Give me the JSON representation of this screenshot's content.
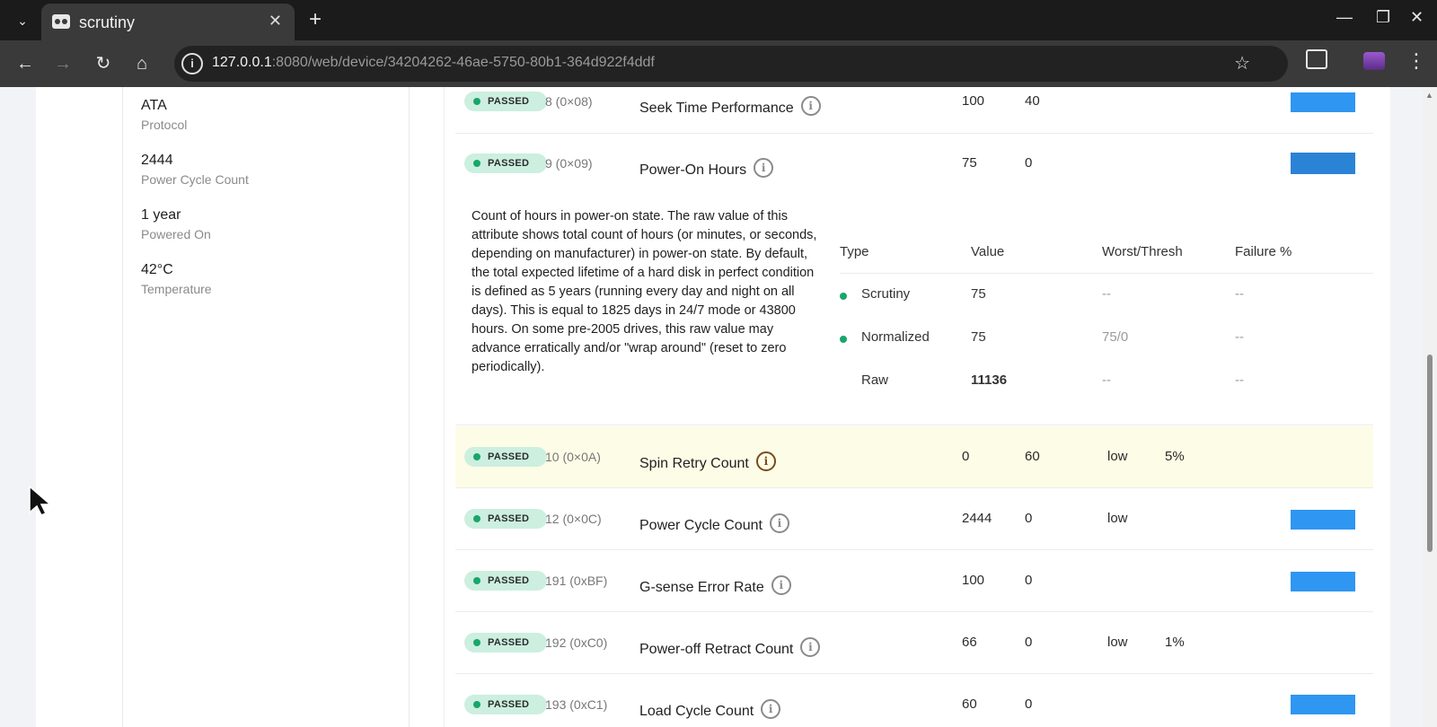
{
  "browser": {
    "tab_title": "scrutiny",
    "url_host": "127.0.0.1",
    "url_rest": ":8080/web/device/34204262-46ae-5750-80b1-364d922f4ddf"
  },
  "device_info": [
    {
      "value": "ATA",
      "label": "Protocol"
    },
    {
      "value": "2444",
      "label": "Power Cycle Count"
    },
    {
      "value": "1 year",
      "label": "Powered On"
    },
    {
      "value": "42°C",
      "label": "Temperature"
    }
  ],
  "status_label": "PASSED",
  "rows": [
    {
      "id": "8 (0×08)",
      "name": "Seek Time Performance",
      "value": "100",
      "worst": "40",
      "thresh": "",
      "fail": ""
    },
    {
      "id": "9 (0×09)",
      "name": "Power-On Hours",
      "value": "75",
      "worst": "0",
      "thresh": "",
      "fail": ""
    },
    {
      "id": "10 (0×0A)",
      "name": "Spin Retry Count",
      "value": "0",
      "worst": "60",
      "thresh": "low",
      "fail": "5%"
    },
    {
      "id": "12 (0×0C)",
      "name": "Power Cycle Count",
      "value": "2444",
      "worst": "0",
      "thresh": "low",
      "fail": ""
    },
    {
      "id": "191 (0xBF)",
      "name": "G-sense Error Rate",
      "value": "100",
      "worst": "0",
      "thresh": "",
      "fail": ""
    },
    {
      "id": "192 (0xC0)",
      "name": "Power-off Retract Count",
      "value": "66",
      "worst": "0",
      "thresh": "low",
      "fail": "1%"
    },
    {
      "id": "193 (0xC1)",
      "name": "Load Cycle Count",
      "value": "60",
      "worst": "0",
      "thresh": "",
      "fail": ""
    }
  ],
  "detail": {
    "description": "Count of hours in power-on state. The raw value of this attribute shows total count of hours (or minutes, or seconds, depending on manufacturer) in power-on state. By default, the total expected lifetime of a hard disk in perfect condition is defined as 5 years (running every day and night on all days). This is equal to 1825 days in 24/7 mode or 43800 hours. On some pre-2005 drives, this raw value may advance erratically and/or \"wrap around\" (reset to zero periodically).",
    "headers": {
      "type": "Type",
      "value": "Value",
      "worst": "Worst/Thresh",
      "failure": "Failure %"
    },
    "rows": [
      {
        "type": "Scrutiny",
        "value": "75",
        "worst": "--",
        "failure": "--"
      },
      {
        "type": "Normalized",
        "value": "75",
        "worst": "75/0",
        "failure": "--"
      },
      {
        "type": "Raw",
        "value": "11136",
        "worst": "--",
        "failure": "--"
      }
    ]
  }
}
